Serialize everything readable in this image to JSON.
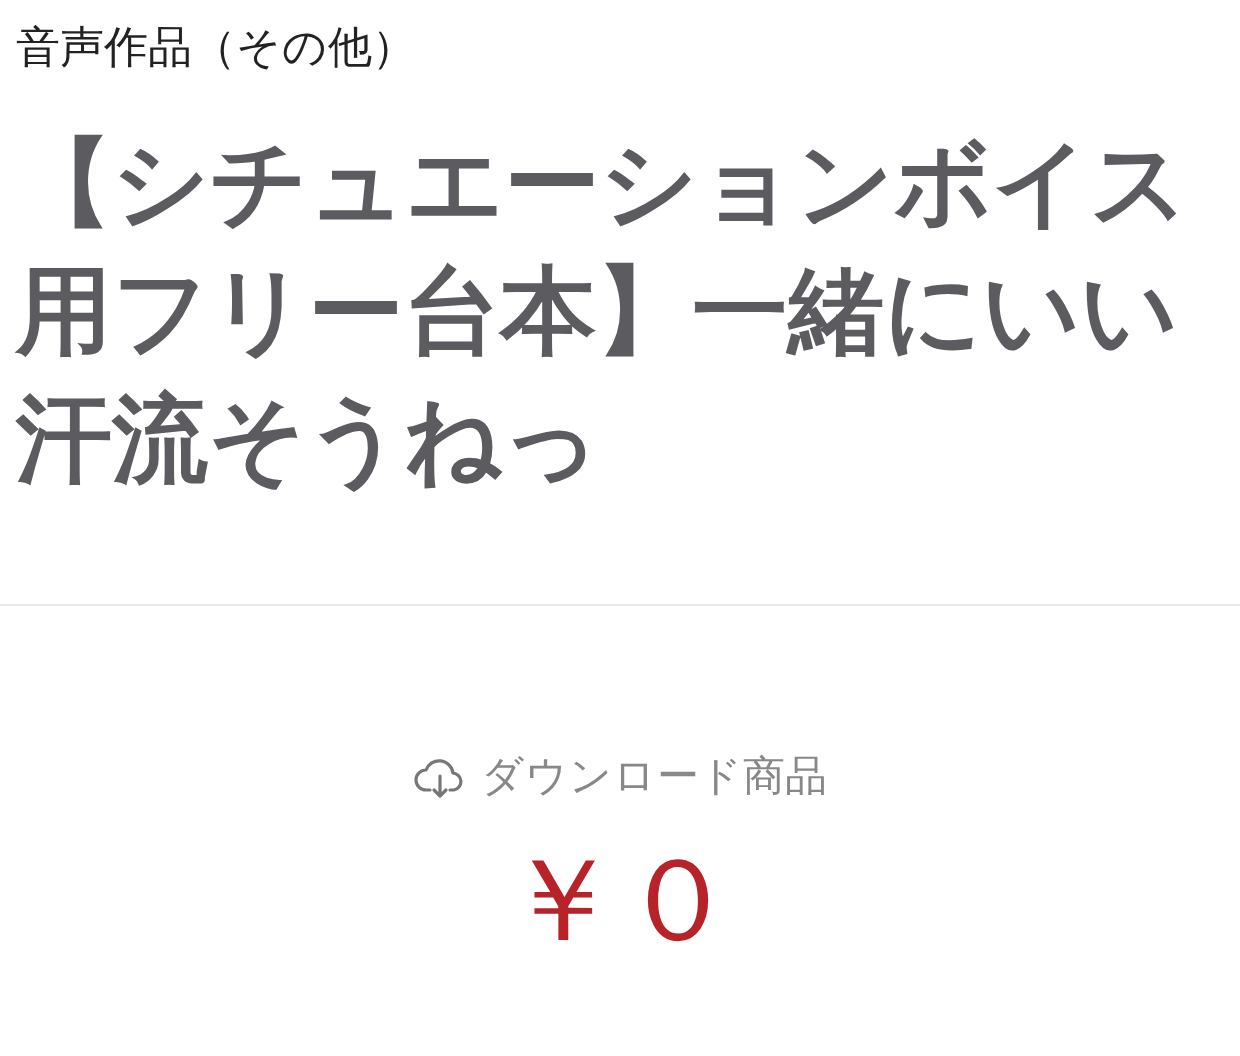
{
  "category": "音声作品（その他）",
  "title": "【シチュエーションボイス用フリー台本】一緒にいい汗流そうねっ",
  "product_type": "ダウンロード商品",
  "price": "￥０"
}
